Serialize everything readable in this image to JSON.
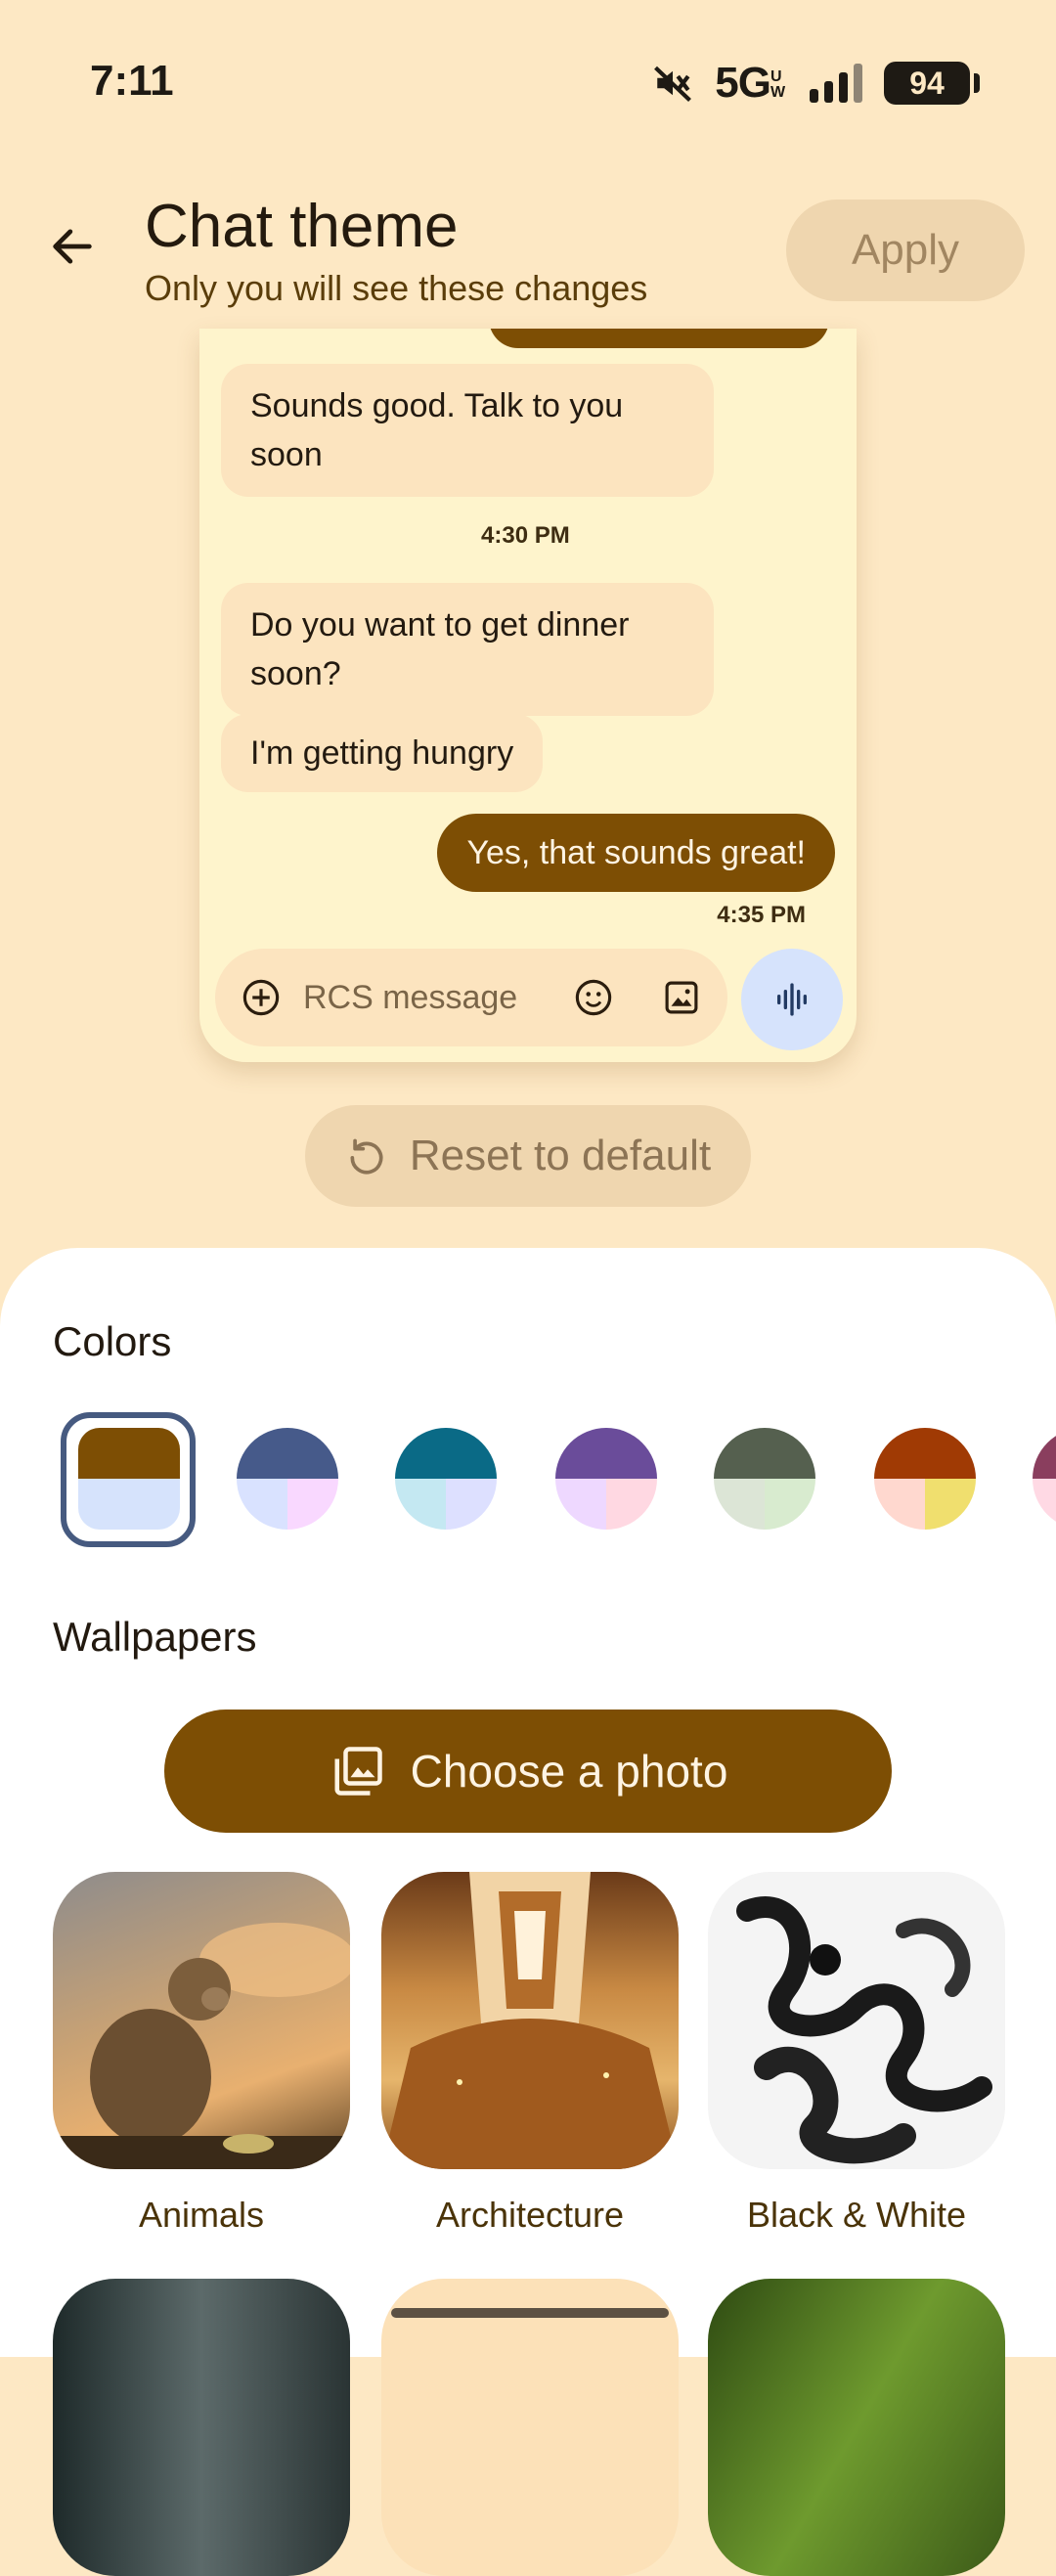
{
  "status_bar": {
    "time": "7:11",
    "network": "5G",
    "network_sub": "UW",
    "battery": "94"
  },
  "header": {
    "title": "Chat theme",
    "subtitle": "Only you will see these changes",
    "apply_label": "Apply"
  },
  "preview": {
    "messages": [
      {
        "direction": "incoming",
        "text": "Sounds good. Talk to you soon"
      },
      {
        "direction": "incoming",
        "text": "Do you want to get dinner soon?"
      },
      {
        "direction": "incoming",
        "text": "I'm getting hungry"
      },
      {
        "direction": "outgoing",
        "text": "Yes, that sounds great!"
      }
    ],
    "timestamps": [
      "4:30 PM",
      "4:35 PM"
    ],
    "composer_placeholder": "RCS message"
  },
  "reset_label": "Reset to default",
  "colors": {
    "label": "Colors",
    "selected_index": 0,
    "swatches": [
      {
        "top": "#7D4E04",
        "bottom_left": "#D6E3FC",
        "bottom_right": "#D6E3FC"
      },
      {
        "top": "#465A8A",
        "bottom_left": "#D9E2FF",
        "bottom_right": "#F9D8FF"
      },
      {
        "top": "#0A6A86",
        "bottom_left": "#C4E8F2",
        "bottom_right": "#DDE0FF"
      },
      {
        "top": "#6A4C9A",
        "bottom_left": "#EED8FF",
        "bottom_right": "#FFD8E2"
      },
      {
        "top": "#55604F",
        "bottom_left": "#DCE5D6",
        "bottom_right": "#D8EBCF"
      },
      {
        "top": "#A03A04",
        "bottom_left": "#FFD8CF",
        "bottom_right": "#F0DF6E"
      },
      {
        "top": "#8A3E5E",
        "bottom_left": "#FFD9E4",
        "bottom_right": "#FFD9E4"
      }
    ]
  },
  "wallpapers": {
    "label": "Wallpapers",
    "choose_label": "Choose a photo",
    "tiles": [
      {
        "label": "Animals"
      },
      {
        "label": "Architecture"
      },
      {
        "label": "Black & White"
      }
    ]
  }
}
